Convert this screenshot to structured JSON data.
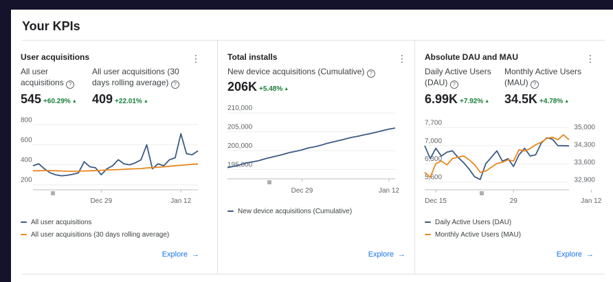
{
  "page": {
    "title": "Your KPIs"
  },
  "colors": {
    "series_primary": "#3a5a84",
    "series_secondary": "#e8861f",
    "positive": "#188038",
    "link": "#1a73e8"
  },
  "icons": {
    "help": "help-circle-icon",
    "more": "more-vert-icon",
    "arrow": "arrow-right-icon"
  },
  "explore_label": "Explore",
  "explore_arrow": "→",
  "help_glyph": "?",
  "more_glyph": "⋮",
  "trend_glyph": "▲",
  "cards": [
    {
      "title": "User acquisitions",
      "metrics": [
        {
          "label_lines": [
            "All user",
            "acquisitions"
          ],
          "value": "545",
          "change": "+60.29%"
        },
        {
          "label_lines": [
            "All user acquisitions (30",
            "days rolling average)"
          ],
          "value": "409",
          "change": "+22.01%"
        }
      ],
      "legend": [
        "All user acquisitions",
        "All user acquisitions (30 days rolling average)"
      ]
    },
    {
      "title": "Total installs",
      "metrics": [
        {
          "label_lines": [
            "New device acquisitions (Cumulative)"
          ],
          "value": "206K",
          "change": "+5.48%"
        }
      ],
      "legend": [
        "New device acquisitions (Cumulative)"
      ]
    },
    {
      "title": "Absolute DAU and MAU",
      "metrics": [
        {
          "label_lines": [
            "Daily Active Users",
            "(DAU)"
          ],
          "value": "6.99K",
          "change": "+7.92%"
        },
        {
          "label_lines": [
            "Monthly Active Users",
            "(MAU)"
          ],
          "value": "34.5K",
          "change": "+4.78%"
        }
      ],
      "legend": [
        "Daily Active Users (DAU)",
        "Monthly Active Users (MAU)"
      ]
    }
  ],
  "chart_data": [
    {
      "type": "line",
      "ylim": [
        150,
        850
      ],
      "y_ticks": [
        "800",
        "600",
        "400",
        "200"
      ],
      "y_tick_values": [
        800,
        600,
        400,
        200
      ],
      "x_tick_labels": [
        "Dec 29",
        "Jan 12"
      ],
      "x_tick_index": [
        12,
        26
      ],
      "series": [
        {
          "name": "All user acquisitions",
          "values": [
            390,
            410,
            360,
            320,
            300,
            290,
            295,
            305,
            320,
            430,
            380,
            370,
            300,
            360,
            390,
            450,
            410,
            400,
            420,
            450,
            600,
            360,
            410,
            390,
            450,
            470,
            710,
            510,
            500,
            540
          ]
        },
        {
          "name": "All user acquisitions (30 days rolling average)",
          "values": [
            340,
            340,
            342,
            342,
            340,
            338,
            336,
            335,
            336,
            338,
            340,
            342,
            345,
            348,
            350,
            352,
            355,
            358,
            360,
            362,
            368,
            372,
            376,
            380,
            385,
            390,
            395,
            400,
            405,
            409
          ]
        }
      ]
    },
    {
      "type": "line",
      "ylim": [
        192500,
        211500
      ],
      "y_ticks": [
        "210,000",
        "205,000",
        "200,000",
        "195,000"
      ],
      "y_tick_values": [
        210000,
        205000,
        200000,
        195000
      ],
      "x_tick_labels": [
        "Dec 29",
        "Jan 12"
      ],
      "x_tick_index": [
        12,
        26
      ],
      "series": [
        {
          "name": "New device acquisitions (Cumulative)",
          "values": [
            195500,
            195800,
            196200,
            196700,
            197000,
            197300,
            197800,
            198200,
            198600,
            199000,
            199500,
            199800,
            200200,
            200700,
            201000,
            201400,
            201900,
            202300,
            202700,
            203100,
            203500,
            203800,
            204200,
            204500,
            204900,
            205300,
            205700,
            206000
          ]
        }
      ]
    },
    {
      "type": "line",
      "ylim": [
        5300,
        8000
      ],
      "y2lim": [
        32500,
        35300
      ],
      "y_ticks": [
        "7,700",
        "7,000",
        "6,300",
        "5,600"
      ],
      "y_tick_values": [
        7700,
        7000,
        6300,
        5600
      ],
      "y2_ticks": [
        "35,000",
        "34,300",
        "33,600",
        "32,900"
      ],
      "y2_tick_values": [
        35000,
        34300,
        33600,
        32900
      ],
      "x_tick_labels": [
        "Dec 15",
        "29",
        "Jan 12"
      ],
      "x_tick_index": [
        2,
        16,
        30
      ],
      "series": [
        {
          "name": "Daily Active Users (DAU)",
          "axis": "left",
          "values": [
            7000,
            6500,
            6900,
            6600,
            6750,
            6800,
            6550,
            6350,
            6100,
            5800,
            5700,
            6300,
            6550,
            6800,
            6400,
            6500,
            6200,
            6650,
            6900,
            6600,
            6650,
            7100,
            7300,
            7250,
            7000,
            7000,
            6990
          ]
        },
        {
          "name": "Monthly Active Users (MAU)",
          "axis": "right",
          "values": [
            33200,
            33000,
            33550,
            33650,
            33500,
            33750,
            33800,
            33850,
            33700,
            33500,
            33200,
            33250,
            33400,
            33550,
            33600,
            33700,
            33650,
            34100,
            34050,
            34150,
            34300,
            34400,
            34550,
            34600,
            34500,
            34700,
            34500
          ]
        }
      ]
    }
  ]
}
